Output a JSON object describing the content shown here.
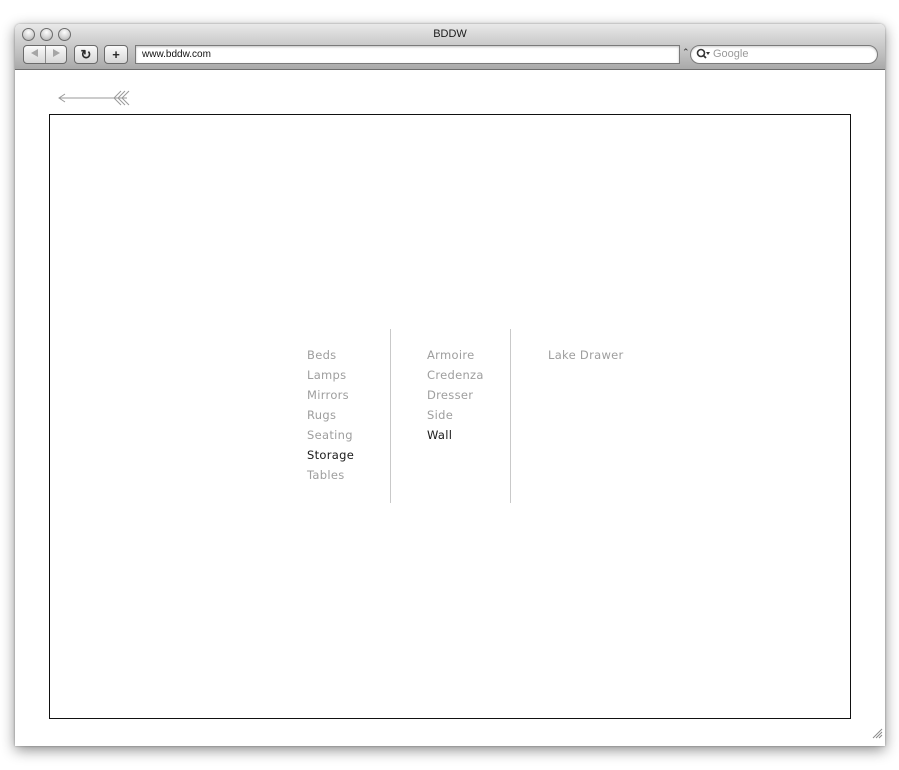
{
  "window": {
    "title": "BDDW"
  },
  "toolbar": {
    "back_icon": "left-triangle",
    "forward_icon": "right-triangle",
    "reload_glyph": "↻",
    "add_glyph": "+",
    "url": "www.bddw.com",
    "search_placeholder": "Google"
  },
  "nav": {
    "categories": [
      {
        "label": "Beds",
        "state": "dim"
      },
      {
        "label": "Lamps",
        "state": "dim"
      },
      {
        "label": "Mirrors",
        "state": "dim"
      },
      {
        "label": "Rugs",
        "state": "dim"
      },
      {
        "label": "Seating",
        "state": "dim"
      },
      {
        "label": "Storage",
        "state": "active"
      },
      {
        "label": "Tables",
        "state": "dim"
      }
    ],
    "subcategories": [
      {
        "label": "Armoire",
        "state": "dim"
      },
      {
        "label": "Credenza",
        "state": "dim"
      },
      {
        "label": "Dresser",
        "state": "dim"
      },
      {
        "label": "Side",
        "state": "dim"
      },
      {
        "label": "Wall",
        "state": "active"
      }
    ],
    "products": [
      {
        "label": "Lake Drawer",
        "state": "dim"
      }
    ]
  },
  "colors": {
    "dim": "#9e9e9e",
    "active": "#1a1a1a",
    "frame": "#111111"
  }
}
